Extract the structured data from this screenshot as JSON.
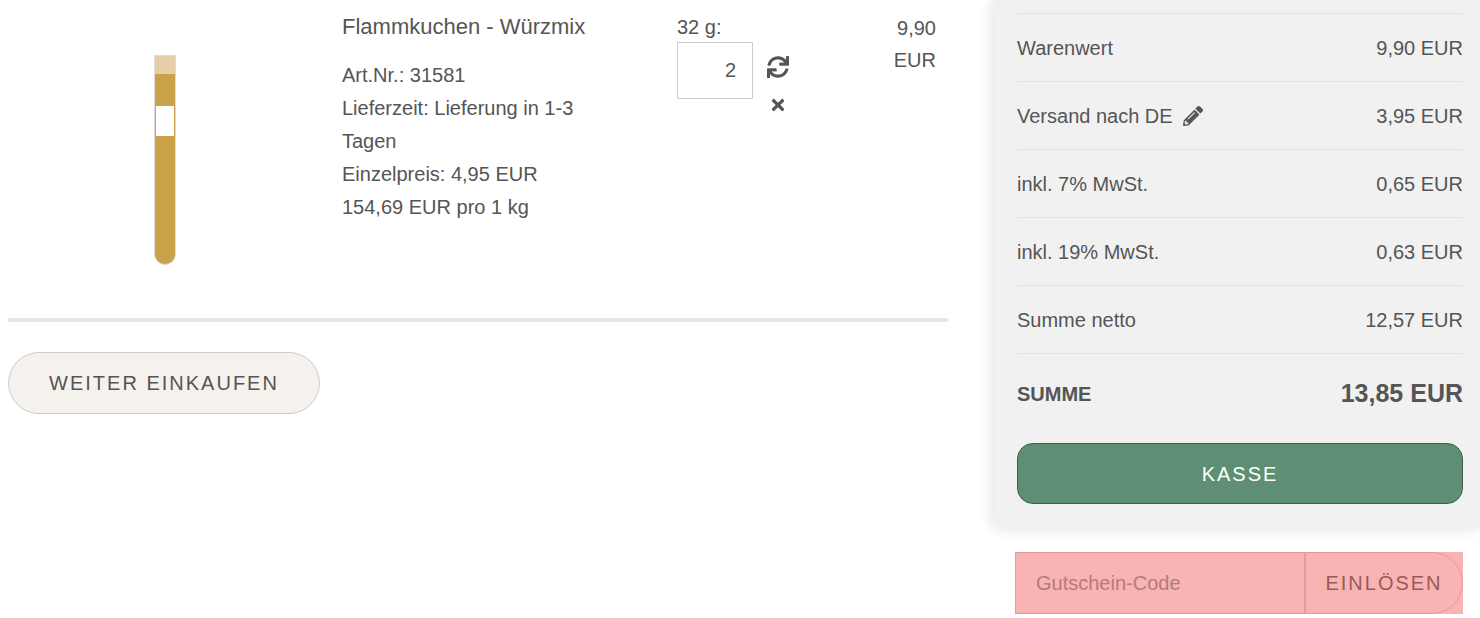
{
  "cart_item": {
    "title": "Flammkuchen - Würzmix",
    "details": [
      "Art.Nr.: 31581",
      "Lieferzeit: Lieferung in 1-3 Tagen",
      "Einzelpreis: 4,95 EUR",
      "154,69 EUR pro 1 kg"
    ],
    "size_label": "32 g:",
    "quantity": "2",
    "price_amount": "9,90",
    "price_currency": "EUR"
  },
  "continue_button": "WEITER EINKAUFEN",
  "summary": {
    "rows": [
      {
        "label": "Warenwert",
        "value": "9,90 EUR",
        "kind": "plain"
      },
      {
        "label": "Versand nach DE",
        "value": "3,95 EUR",
        "kind": "editable"
      },
      {
        "label": "inkl. 7% MwSt.",
        "value": "0,65 EUR",
        "kind": "plain"
      },
      {
        "label": "inkl. 19% MwSt.",
        "value": "0,63 EUR",
        "kind": "plain"
      },
      {
        "label": "Summe netto",
        "value": "12,57 EUR",
        "kind": "plain"
      }
    ],
    "total_label": "SUMME",
    "total_value": "13,85 EUR",
    "checkout_button": "KASSE"
  },
  "coupon": {
    "placeholder": "Gutschein-Code",
    "button": "EINLÖSEN"
  }
}
